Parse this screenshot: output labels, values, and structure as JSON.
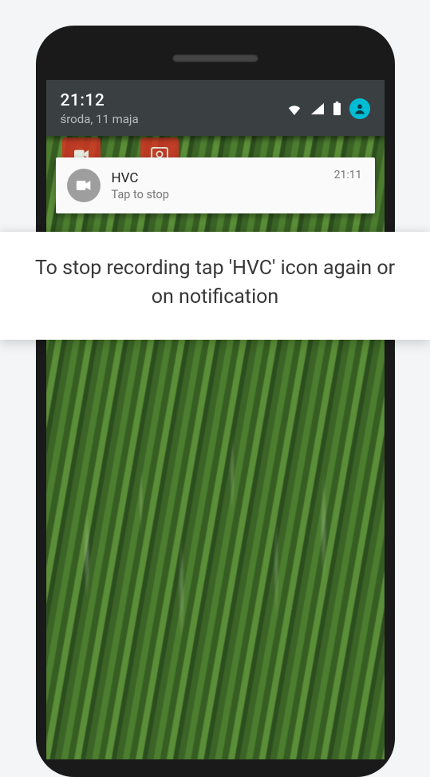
{
  "shade": {
    "time": "21:12",
    "date": "środa, 11 maja"
  },
  "notification": {
    "title": "HVC",
    "subtitle": "Tap to stop",
    "time": "21:11"
  },
  "caption": "To stop recording tap 'HVC' icon again or on notification",
  "colors": {
    "shade_bg": "#3a4042",
    "profile_bg": "#00bcd4",
    "notif_bg": "#fafafa",
    "accent_red": "#d33424"
  }
}
